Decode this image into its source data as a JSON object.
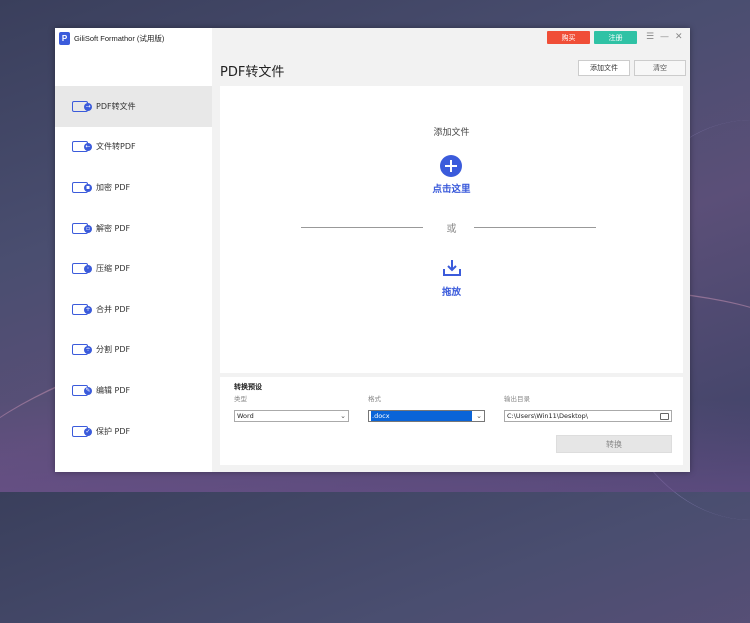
{
  "app": {
    "title": "GiliSoft Formathor (试用版)",
    "logo_letter": "P"
  },
  "titlebar": {
    "buy_label": "购买",
    "register_label": "注册",
    "menu_glyph": "☰",
    "minimize_glyph": "—",
    "close_glyph": "✕"
  },
  "sidebar": {
    "items": [
      {
        "label": "PDF转文件",
        "icon": "pdf-to-file-icon",
        "active": true
      },
      {
        "label": "文件转PDF",
        "icon": "file-to-pdf-icon"
      },
      {
        "label": "加密 PDF",
        "icon": "lock-icon"
      },
      {
        "label": "解密 PDF",
        "icon": "unlock-icon"
      },
      {
        "label": "压缩 PDF",
        "icon": "compress-icon"
      },
      {
        "label": "合并 PDF",
        "icon": "merge-icon"
      },
      {
        "label": "分割 PDF",
        "icon": "split-icon"
      },
      {
        "label": "编辑 PDF",
        "icon": "edit-icon"
      },
      {
        "label": "保护 PDF",
        "icon": "protect-icon"
      }
    ]
  },
  "main": {
    "title": "PDF转文件",
    "add_file_label": "添加文件",
    "clear_label": "清空",
    "dropzone": {
      "title": "添加文件",
      "click_label": "点击这里",
      "or_label": "或",
      "drag_label": "拖放"
    },
    "settings": {
      "title": "转换预设",
      "type_label": "类型",
      "type_value": "Word",
      "format_label": "格式",
      "format_value": ".docx",
      "output_label": "输出目录",
      "output_value": "C:\\Users\\Win11\\Desktop\\",
      "convert_label": "转换"
    }
  },
  "colors": {
    "accent": "#3b5bdb",
    "buy": "#f04e37",
    "register": "#2fc2a5"
  }
}
